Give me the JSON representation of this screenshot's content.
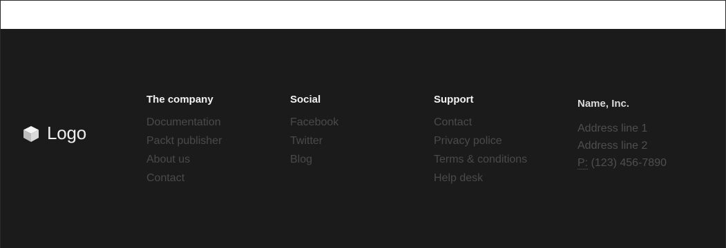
{
  "brand": {
    "icon": "cube-icon",
    "label": "Logo"
  },
  "columns": [
    {
      "title": "The company",
      "links": [
        "Documentation",
        "Packt publisher",
        "About us",
        "Contact"
      ]
    },
    {
      "title": "Social",
      "links": [
        "Facebook",
        "Twitter",
        "Blog"
      ]
    },
    {
      "title": "Support",
      "links": [
        "Contact",
        "Privacy police",
        "Terms & conditions",
        "Help desk"
      ]
    }
  ],
  "address": {
    "title": "Name, Inc.",
    "line1": "Address line 1",
    "line2": "Address line 2",
    "phone_abbr": "P:",
    "phone": " (123) 456-7890"
  },
  "colors": {
    "footer_background": "#1b1b1b",
    "heading_text": "#f2f2f2",
    "link_text": "#4a4a4a"
  }
}
